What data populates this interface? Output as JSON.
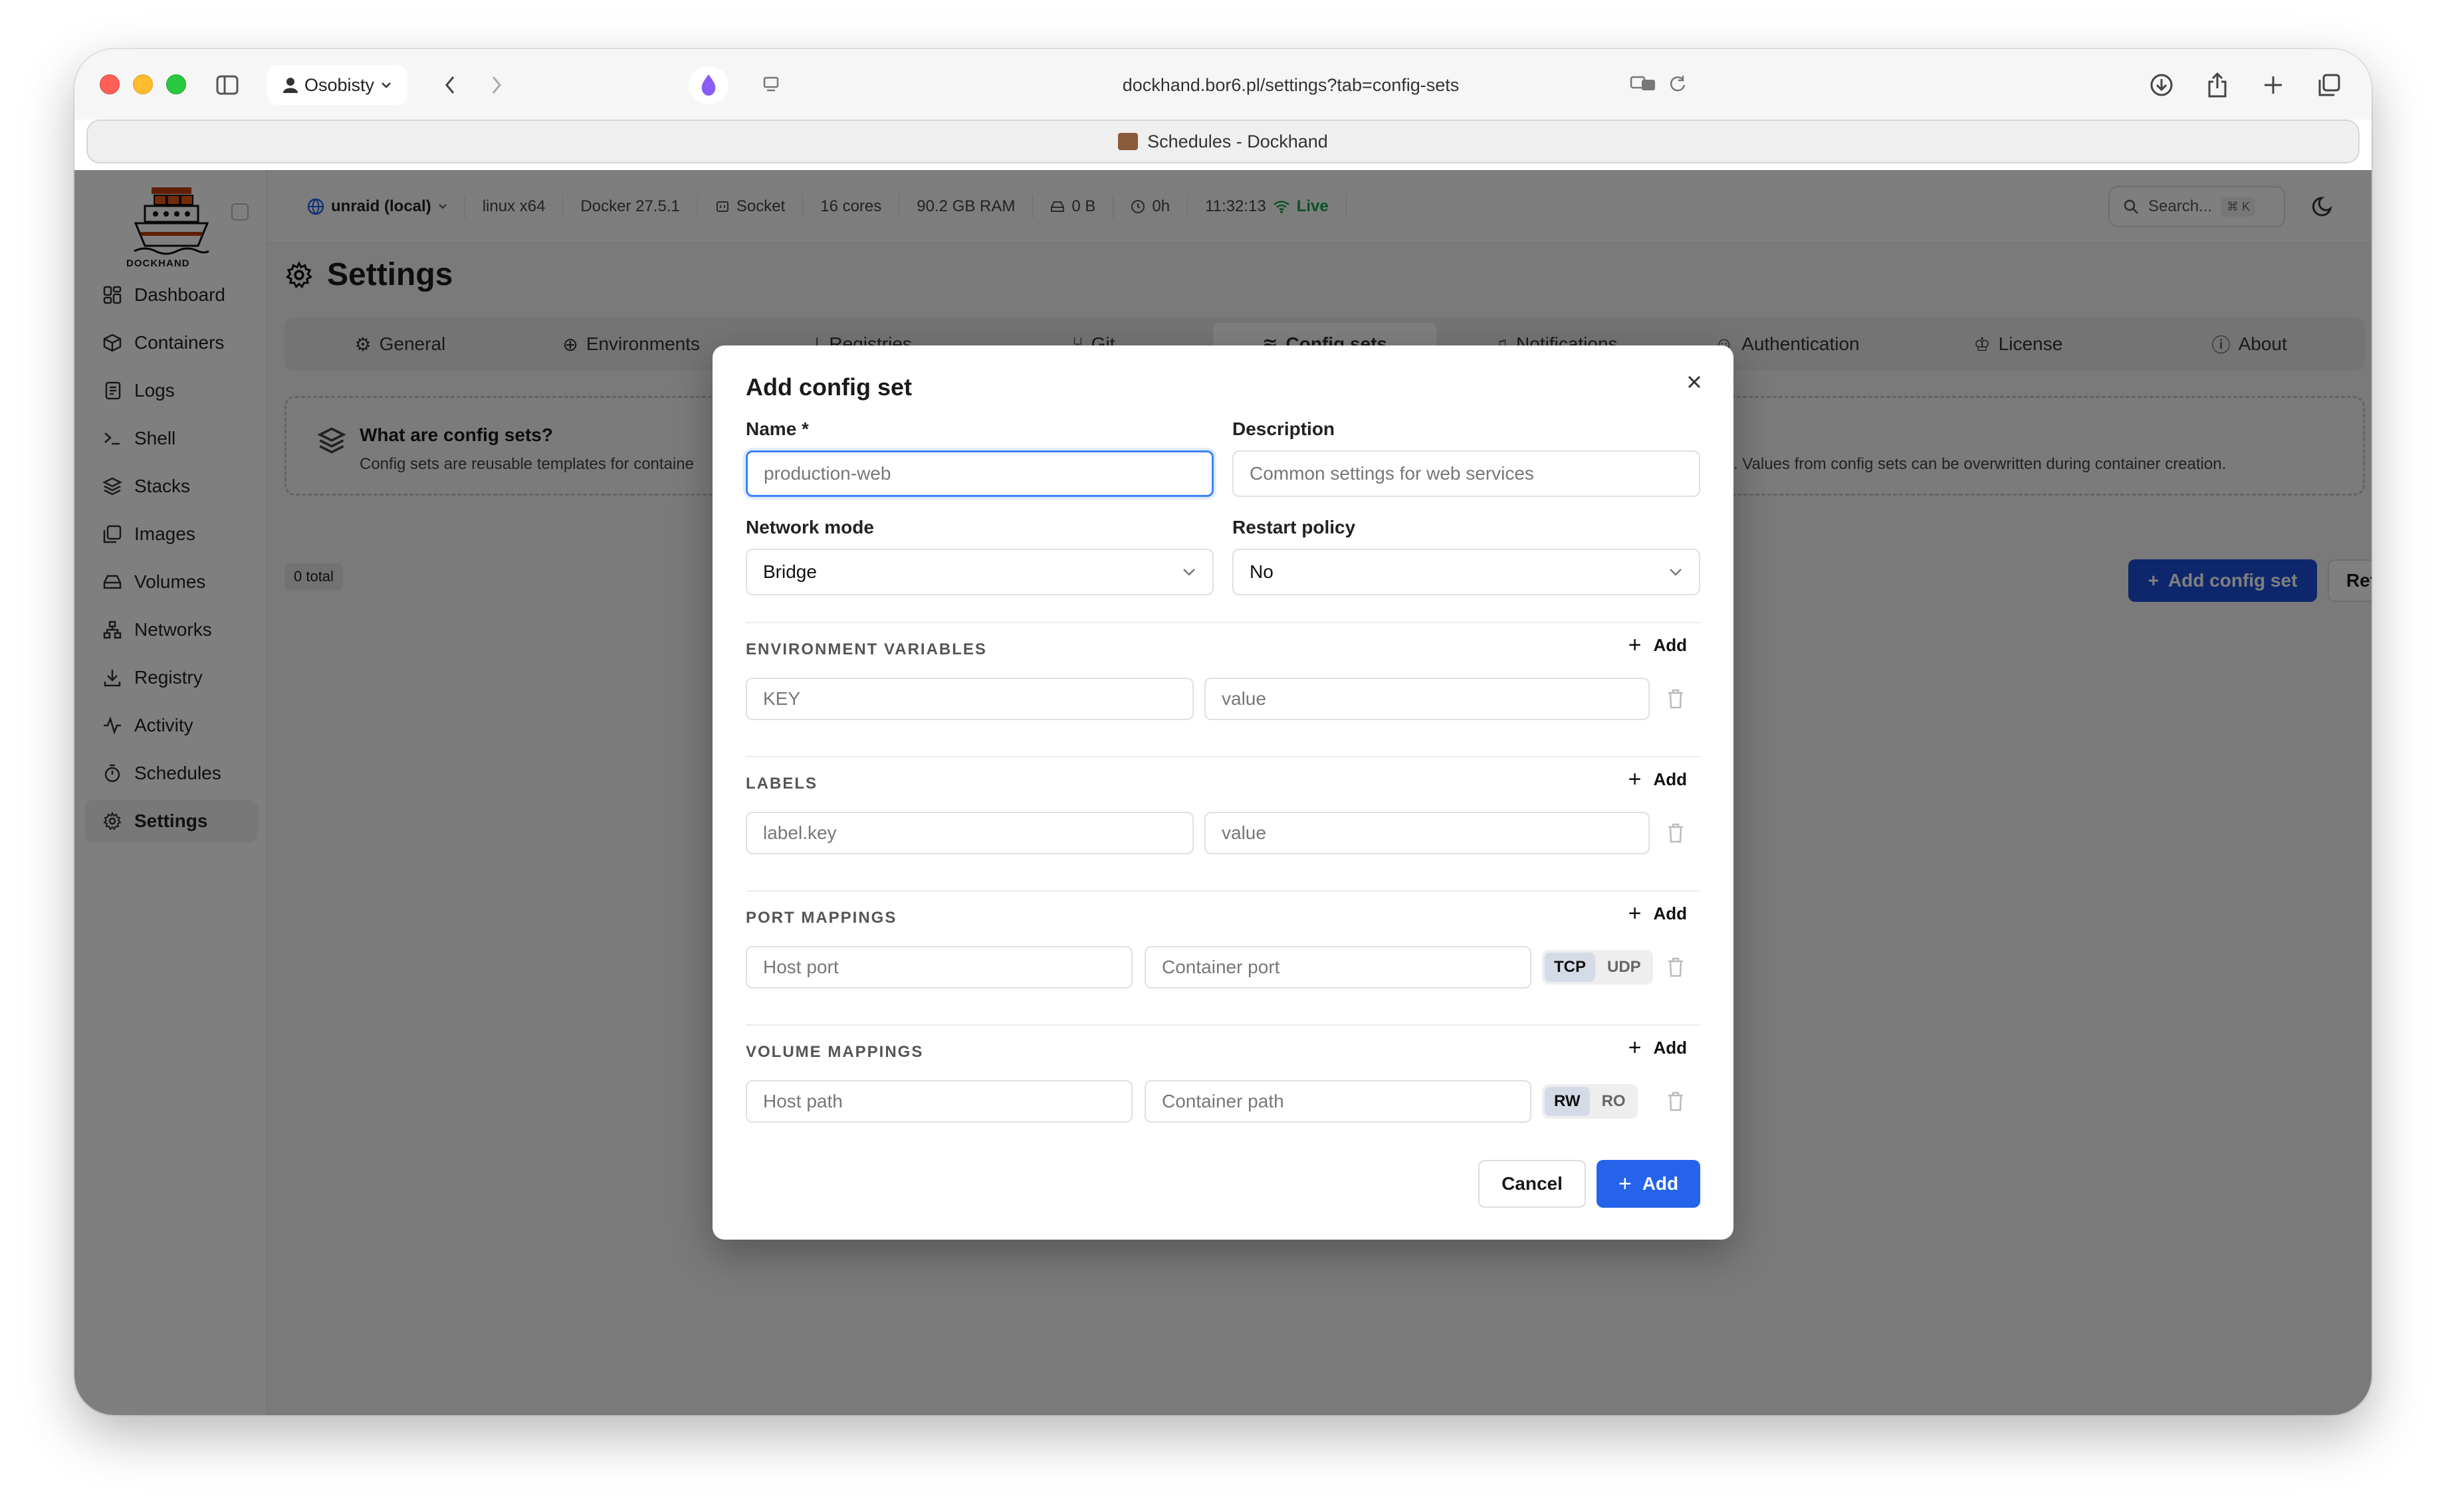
{
  "browser": {
    "profile": "Osobisty",
    "url": "dockhand.bor6.pl/settings?tab=config-sets",
    "tab_title": "Schedules - Dockhand"
  },
  "sidebar": {
    "logo_text": "DOCKHAND",
    "items": [
      {
        "label": "Dashboard",
        "icon": "dashboard-icon"
      },
      {
        "label": "Containers",
        "icon": "box-icon"
      },
      {
        "label": "Logs",
        "icon": "logs-icon"
      },
      {
        "label": "Shell",
        "icon": "terminal-icon"
      },
      {
        "label": "Stacks",
        "icon": "layers-icon"
      },
      {
        "label": "Images",
        "icon": "images-icon"
      },
      {
        "label": "Volumes",
        "icon": "hard-drive-icon"
      },
      {
        "label": "Networks",
        "icon": "network-icon"
      },
      {
        "label": "Registry",
        "icon": "download-icon"
      },
      {
        "label": "Activity",
        "icon": "activity-icon"
      },
      {
        "label": "Schedules",
        "icon": "timer-icon"
      },
      {
        "label": "Settings",
        "icon": "gear-icon",
        "active": true
      }
    ]
  },
  "topbar": {
    "environment": "unraid (local)",
    "platform": "linux x64",
    "docker": "Docker 27.5.1",
    "connection": "Socket",
    "cores": "16 cores",
    "ram": "90.2 GB RAM",
    "disk": "0 B",
    "uptime": "0h",
    "time": "11:32:13",
    "status": "Live",
    "search_placeholder": "Search...",
    "search_shortcut": "⌘ K"
  },
  "page": {
    "title": "Settings",
    "tabs": [
      "General",
      "Environments",
      "Registries",
      "Git",
      "Config sets",
      "Notifications",
      "Authentication",
      "License",
      "About"
    ],
    "active_tab": "Config sets",
    "info_title": "What are config sets?",
    "info_desc_left": "Config sets are reusable templates for containe",
    "info_desc_right": "iners. Values from config sets can be overwritten during container creation.",
    "count": "0 total",
    "add_button": "Add config set",
    "refresh_button": "Refresh"
  },
  "modal": {
    "title": "Add config set",
    "name_label": "Name *",
    "name_placeholder": "production-web",
    "description_label": "Description",
    "description_placeholder": "Common settings for web services",
    "network_label": "Network mode",
    "network_value": "Bridge",
    "restart_label": "Restart policy",
    "restart_value": "No",
    "add_label": "Add",
    "env_title": "ENVIRONMENT VARIABLES",
    "env_key_placeholder": "KEY",
    "env_value_placeholder": "value",
    "labels_title": "LABELS",
    "label_key_placeholder": "label.key",
    "label_value_placeholder": "value",
    "ports_title": "PORT MAPPINGS",
    "host_port_placeholder": "Host port",
    "container_port_placeholder": "Container port",
    "protocol_options": [
      "TCP",
      "UDP"
    ],
    "protocol_selected": "TCP",
    "volumes_title": "VOLUME MAPPINGS",
    "host_path_placeholder": "Host path",
    "container_path_placeholder": "Container path",
    "mode_options": [
      "RW",
      "RO"
    ],
    "mode_selected": "RW",
    "cancel_button": "Cancel",
    "submit_button": "Add"
  },
  "colors": {
    "primary": "#2563eb",
    "primary_dark": "#1d4ed8",
    "live": "#16a34a",
    "overlay": "rgba(0,0,0,0.5)"
  }
}
